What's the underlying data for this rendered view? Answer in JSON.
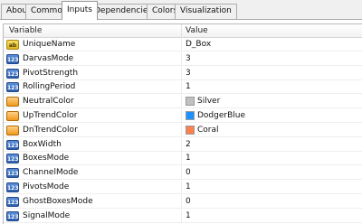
{
  "tabs": [
    "About",
    "Common",
    "Inputs",
    "Dependencies",
    "Colors",
    "Visualization"
  ],
  "active_tab": "Inputs",
  "columns": {
    "variable": "Variable",
    "value": "Value"
  },
  "icons": {
    "num": "123",
    "str": "ab",
    "color": "color-icon"
  },
  "rows": [
    {
      "type": "str",
      "name": "UniqueName",
      "value": "D_Box"
    },
    {
      "type": "num",
      "name": "DarvasMode",
      "value": "3"
    },
    {
      "type": "num",
      "name": "PivotStrength",
      "value": "3"
    },
    {
      "type": "num",
      "name": "RollingPeriod",
      "value": "1"
    },
    {
      "type": "color",
      "name": "NeutralColor",
      "value": "Silver",
      "swatch": "#c0c0c0"
    },
    {
      "type": "color",
      "name": "UpTrendColor",
      "value": "DodgerBlue",
      "swatch": "#1e90ff"
    },
    {
      "type": "color",
      "name": "DnTrendColor",
      "value": "Coral",
      "swatch": "#ff7f50"
    },
    {
      "type": "num",
      "name": "BoxWidth",
      "value": "2"
    },
    {
      "type": "num",
      "name": "BoxesMode",
      "value": "1"
    },
    {
      "type": "num",
      "name": "ChannelMode",
      "value": "0"
    },
    {
      "type": "num",
      "name": "PivotsMode",
      "value": "1"
    },
    {
      "type": "num",
      "name": "GhostBoxesMode",
      "value": "0"
    },
    {
      "type": "num",
      "name": "SignalMode",
      "value": "1"
    }
  ]
}
